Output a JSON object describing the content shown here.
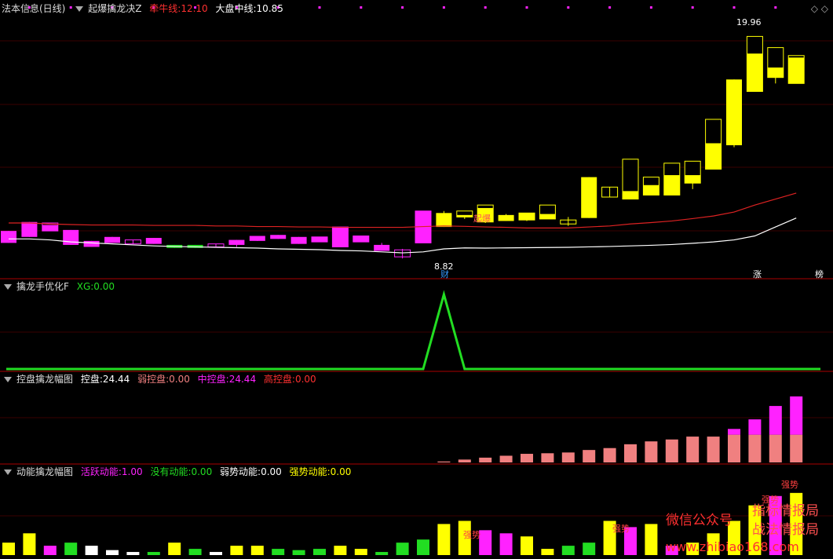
{
  "header": {
    "title": "法本信息(日线)",
    "indicator_name": "起爆擒龙决Z",
    "bull_label": "牵牛线:",
    "bull_value": "12.10",
    "market_label": "大盘中线:",
    "market_value": "10.85"
  },
  "panel2": {
    "name": "擒龙手优化F",
    "xg_label": "XG:",
    "xg_value": "0.00"
  },
  "panel3": {
    "name": "控盘擒龙幅图",
    "k_label": "控盘:",
    "k_value": "24.44",
    "weak_label": "弱控盘:",
    "weak_value": "0.00",
    "mid_label": "中控盘:",
    "mid_value": "24.44",
    "high_label": "高控盘:",
    "high_value": "0.00"
  },
  "panel4": {
    "name": "动能擒龙幅图",
    "active_label": "活跃动能:",
    "active_value": "1.00",
    "none_label": "没有动能:",
    "none_value": "0.00",
    "weak_label": "弱势动能:",
    "weak_value": "0.00",
    "strong_label": "强势动能:",
    "strong_value": "0.00"
  },
  "annotations": {
    "high_price": "19.96",
    "low_price": "8.82",
    "cai": "财",
    "qibao": "起爆",
    "zhang": "涨",
    "bang": "榜",
    "qiangshi": "强势"
  },
  "watermark": {
    "line1": "微信公众号",
    "line2a": "指标情报局",
    "line2b": "战法情报局",
    "line3": "www.zhibiao168.com"
  },
  "colors": {
    "magenta": "#ff22ff",
    "yellow": "#ffff00",
    "green": "#22dd22",
    "red": "#dd2222",
    "salmon": "#f08080",
    "white": "#ffffff"
  },
  "chart_data": [
    {
      "type": "candlestick",
      "title": "起爆擒龙决Z",
      "ylim": [
        8.0,
        21.0
      ],
      "candles": [
        {
          "o": 10.2,
          "c": 9.6,
          "h": 10.2,
          "l": 9.6,
          "color": "magenta"
        },
        {
          "o": 10.65,
          "c": 9.9,
          "h": 10.65,
          "l": 9.9,
          "color": "magenta"
        },
        {
          "o": 10.5,
          "c": 10.2,
          "h": 10.6,
          "l": 10.2,
          "color": "magenta",
          "hollow_top": true
        },
        {
          "o": 10.25,
          "c": 9.5,
          "h": 10.25,
          "l": 9.5,
          "color": "magenta"
        },
        {
          "o": 9.7,
          "c": 9.4,
          "h": 9.7,
          "l": 9.4,
          "color": "magenta"
        },
        {
          "o": 9.9,
          "c": 9.6,
          "h": 9.9,
          "l": 9.6,
          "color": "magenta"
        },
        {
          "o": 9.75,
          "c": 9.55,
          "h": 9.75,
          "l": 9.55,
          "color": "magenta",
          "hollow": true
        },
        {
          "o": 9.85,
          "c": 9.55,
          "h": 9.85,
          "l": 9.55,
          "color": "magenta"
        },
        {
          "o": 9.35,
          "c": 9.5,
          "h": 9.5,
          "l": 9.35,
          "color": "green"
        },
        {
          "o": 9.35,
          "c": 9.5,
          "h": 9.5,
          "l": 9.35,
          "color": "green"
        },
        {
          "o": 9.4,
          "c": 9.55,
          "h": 9.55,
          "l": 9.4,
          "color": "magenta",
          "hollow": true
        },
        {
          "o": 9.75,
          "c": 9.5,
          "h": 9.75,
          "l": 9.4,
          "color": "magenta"
        },
        {
          "o": 9.95,
          "c": 9.7,
          "h": 9.95,
          "l": 9.7,
          "color": "magenta"
        },
        {
          "o": 10.0,
          "c": 9.8,
          "h": 10.0,
          "l": 9.8,
          "color": "magenta"
        },
        {
          "o": 9.9,
          "c": 9.55,
          "h": 9.9,
          "l": 9.55,
          "color": "magenta"
        },
        {
          "o": 9.9,
          "c": 9.65,
          "h": 9.9,
          "l": 9.65,
          "color": "magenta",
          "hollow_top": true
        },
        {
          "o": 10.4,
          "c": 9.4,
          "h": 10.4,
          "l": 9.4,
          "color": "magenta",
          "hollow_top": true
        },
        {
          "o": 9.95,
          "c": 9.65,
          "h": 9.95,
          "l": 9.65,
          "color": "magenta",
          "hollow_top": true
        },
        {
          "o": 9.5,
          "c": 9.2,
          "h": 9.6,
          "l": 9.2,
          "color": "magenta"
        },
        {
          "o": 9.25,
          "c": 8.9,
          "h": 9.3,
          "l": 8.82,
          "color": "magenta",
          "hollow": true
        },
        {
          "o": 9.6,
          "c": 11.2,
          "h": 11.2,
          "l": 9.6,
          "color": "magenta",
          "hollow_top": true
        },
        {
          "o": 10.4,
          "c": 11.1,
          "h": 11.2,
          "l": 10.4,
          "color": "yellow"
        },
        {
          "o": 10.9,
          "c": 11.0,
          "h": 11.2,
          "l": 10.8,
          "color": "yellow",
          "hollow_top": true
        },
        {
          "o": 10.65,
          "c": 11.35,
          "h": 11.5,
          "l": 10.6,
          "color": "yellow",
          "hollow_top": true
        },
        {
          "o": 10.7,
          "c": 11.0,
          "h": 11.05,
          "l": 10.7,
          "color": "yellow"
        },
        {
          "o": 10.75,
          "c": 11.1,
          "h": 11.1,
          "l": 10.7,
          "color": "yellow",
          "hollow_top": true
        },
        {
          "o": 10.8,
          "c": 11.05,
          "h": 11.5,
          "l": 10.8,
          "color": "yellow",
          "hollow_top": true
        },
        {
          "o": 10.55,
          "c": 10.75,
          "h": 10.9,
          "l": 10.45,
          "color": "yellow",
          "hollow": true
        },
        {
          "o": 10.85,
          "c": 12.9,
          "h": 12.9,
          "l": 10.85,
          "color": "yellow"
        },
        {
          "o": 11.9,
          "c": 12.4,
          "h": 12.4,
          "l": 11.9,
          "color": "yellow",
          "hollow": true
        },
        {
          "o": 12.2,
          "c": 11.8,
          "h": 13.8,
          "l": 11.8,
          "color": "yellow",
          "hollow_top": true
        },
        {
          "o": 12.0,
          "c": 12.5,
          "h": 12.9,
          "l": 12.0,
          "color": "yellow",
          "hollow_top": true
        },
        {
          "o": 12.0,
          "c": 13.0,
          "h": 13.6,
          "l": 12.0,
          "color": "yellow",
          "hollow_top": true
        },
        {
          "o": 12.6,
          "c": 13.0,
          "h": 13.7,
          "l": 12.3,
          "color": "yellow",
          "hollow_top": true
        },
        {
          "o": 13.3,
          "c": 14.6,
          "h": 15.8,
          "l": 13.3,
          "color": "yellow",
          "hollow_top": true
        },
        {
          "o": 14.5,
          "c": 17.8,
          "h": 17.8,
          "l": 14.4,
          "color": "yellow"
        },
        {
          "o": 17.2,
          "c": 19.1,
          "h": 19.96,
          "l": 17.2,
          "color": "yellow",
          "hollow_top": true
        },
        {
          "o": 17.9,
          "c": 18.4,
          "h": 19.4,
          "l": 17.6,
          "color": "yellow",
          "hollow_top": true
        },
        {
          "o": 17.6,
          "c": 18.9,
          "h": 19.0,
          "l": 17.6,
          "color": "yellow",
          "hollow_top": true
        }
      ],
      "series": [
        {
          "name": "牵牛线",
          "color": "red",
          "values": [
            10.6,
            10.6,
            10.55,
            10.52,
            10.5,
            10.5,
            10.5,
            10.48,
            10.48,
            10.48,
            10.45,
            10.45,
            10.42,
            10.42,
            10.4,
            10.4,
            10.38,
            10.38,
            10.38,
            10.38,
            10.42,
            10.45,
            10.43,
            10.4,
            10.38,
            10.35,
            10.35,
            10.35,
            10.4,
            10.45,
            10.55,
            10.62,
            10.7,
            10.82,
            10.95,
            11.15,
            11.5,
            11.8,
            12.1
          ]
        },
        {
          "name": "大盘中线",
          "color": "white",
          "values": [
            9.8,
            9.8,
            9.75,
            9.65,
            9.6,
            9.55,
            9.5,
            9.45,
            9.42,
            9.4,
            9.38,
            9.36,
            9.34,
            9.3,
            9.28,
            9.26,
            9.22,
            9.2,
            9.15,
            9.1,
            9.15,
            9.3,
            9.35,
            9.34,
            9.35,
            9.36,
            9.37,
            9.38,
            9.4,
            9.42,
            9.45,
            9.48,
            9.52,
            9.58,
            9.65,
            9.75,
            9.95,
            10.4,
            10.85
          ]
        }
      ]
    },
    {
      "type": "line",
      "title": "擒龙手优化F",
      "ylim": [
        0,
        1
      ],
      "series": [
        {
          "name": "XG",
          "values": [
            0,
            0,
            0,
            0,
            0,
            0,
            0,
            0,
            0,
            0,
            0,
            0,
            0,
            0,
            0,
            0,
            0,
            0,
            0,
            0,
            0,
            1,
            0,
            0,
            0,
            0,
            0,
            0,
            0,
            0,
            0,
            0,
            0,
            0,
            0,
            0,
            0,
            0,
            0
          ]
        }
      ]
    },
    {
      "type": "bar",
      "title": "控盘擒龙幅图",
      "ylim": [
        0,
        32
      ],
      "series": [
        {
          "name": "中控盘",
          "values": [
            0,
            0,
            0,
            0,
            0,
            0,
            0,
            0,
            0,
            0,
            0,
            0,
            0,
            0,
            0,
            0,
            0,
            0,
            0,
            0,
            0,
            0.5,
            1.5,
            2.5,
            3.5,
            4.5,
            4.8,
            5.2,
            6.5,
            7.5,
            9.5,
            11,
            12,
            13.5,
            13.5,
            14.5,
            14.5,
            14.5,
            14.5
          ]
        },
        {
          "name": "高控盘",
          "values": [
            0,
            0,
            0,
            0,
            0,
            0,
            0,
            0,
            0,
            0,
            0,
            0,
            0,
            0,
            0,
            0,
            0,
            0,
            0,
            0,
            0,
            0,
            0,
            0,
            0,
            0,
            0,
            0,
            0,
            0,
            0,
            0,
            0,
            0,
            0,
            3,
            8,
            15,
            20,
            23
          ]
        }
      ]
    },
    {
      "type": "bar",
      "title": "动能擒龙幅图",
      "ylim": [
        0,
        1.2
      ],
      "values": [
        0.2,
        0.35,
        0.15,
        0.2,
        0.15,
        0.08,
        0.05,
        0.05,
        0.2,
        0.1,
        0.05,
        0.15,
        0.15,
        0.1,
        0.08,
        0.1,
        0.15,
        0.1,
        0.05,
        0.2,
        0.25,
        0.5,
        0.55,
        0.4,
        0.35,
        0.3,
        0.1,
        0.15,
        0.2,
        0.55,
        0.45,
        0.5,
        0.15,
        0.2,
        0.35,
        0.55,
        0.8,
        0.95,
        1.0
      ],
      "colors": [
        "yellow",
        "yellow",
        "magenta",
        "green",
        "white",
        "white",
        "white",
        "green",
        "yellow",
        "green",
        "white",
        "yellow",
        "yellow",
        "green",
        "green",
        "green",
        "yellow",
        "yellow",
        "green",
        "green",
        "green",
        "yellow",
        "yellow",
        "magenta",
        "magenta",
        "yellow",
        "yellow",
        "green",
        "green",
        "yellow",
        "magenta",
        "yellow",
        "magenta",
        "yellow",
        "yellow",
        "yellow",
        "yellow",
        "magenta",
        "yellow"
      ]
    }
  ]
}
